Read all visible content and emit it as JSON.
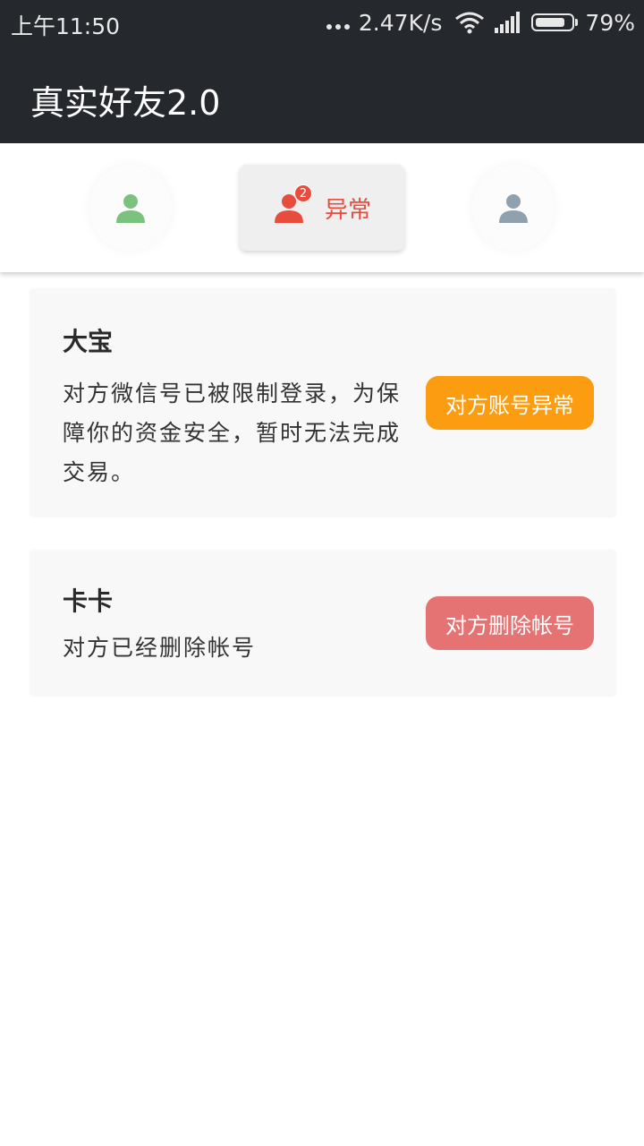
{
  "status_bar": {
    "time": "上午11:50",
    "net_speed": "2.47K/s",
    "battery_percent": "79%",
    "battery_level": 0.79
  },
  "app_bar": {
    "title": "真实好友2.0"
  },
  "tabs": [
    {
      "icon": "user-icon-green",
      "label": "",
      "color": "#7cc27f"
    },
    {
      "icon": "user-icon-red",
      "label": "异常",
      "badge": "2",
      "color": "#e84c3d"
    },
    {
      "icon": "user-icon-gray",
      "label": "",
      "color": "#8fa0ae"
    }
  ],
  "cards": [
    {
      "name": "大宝",
      "description": "对方微信号已被限制登录，为保障你的资金安全，暂时无法完成交易。",
      "action": "对方账号异常",
      "action_color": "#fc9c10"
    },
    {
      "name": "卡卡",
      "description": "对方已经删除帐号",
      "action": "对方删除帐号",
      "action_color": "#e57373"
    }
  ]
}
